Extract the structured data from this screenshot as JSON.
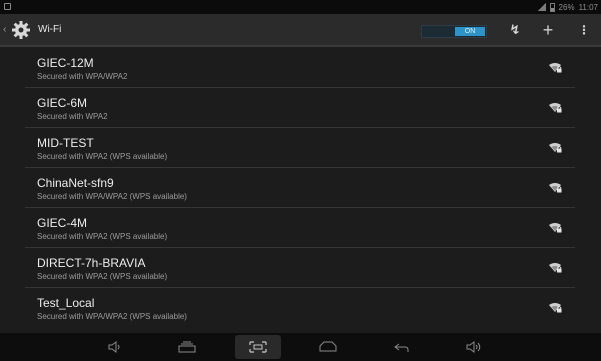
{
  "status_bar": {
    "battery_text": "26%",
    "time": "11:07"
  },
  "action_bar": {
    "title": "Wi-Fi",
    "toggle_label": "ON",
    "icons": [
      "chevron-left-icon",
      "settings-gear-icon",
      "wps-icon",
      "add-icon",
      "overflow-menu-icon"
    ]
  },
  "networks": [
    {
      "ssid": "GIEC-12M",
      "security": "Secured with WPA/WPA2"
    },
    {
      "ssid": "GIEC-6M",
      "security": "Secured with WPA2"
    },
    {
      "ssid": "MID-TEST",
      "security": "Secured with WPA2 (WPS available)"
    },
    {
      "ssid": "ChinaNet-sfn9",
      "security": "Secured with WPA/WPA2 (WPS available)"
    },
    {
      "ssid": "GIEC-4M",
      "security": "Secured with WPA2 (WPS available)"
    },
    {
      "ssid": "DIRECT-7h-BRAVIA",
      "security": "Secured with WPA2 (WPS available)"
    },
    {
      "ssid": "Test_Local",
      "security": "Secured with WPA/WPA2 (WPS available)"
    }
  ],
  "nav_bar": {
    "icons": [
      "volume-down-icon",
      "recent-apps-icon",
      "screenshot-icon",
      "home-icon",
      "back-icon",
      "volume-up-icon"
    ]
  },
  "colors": {
    "accent": "#2e93c7",
    "background": "#1c1c1c",
    "action_bar": "#2b2b2b"
  }
}
